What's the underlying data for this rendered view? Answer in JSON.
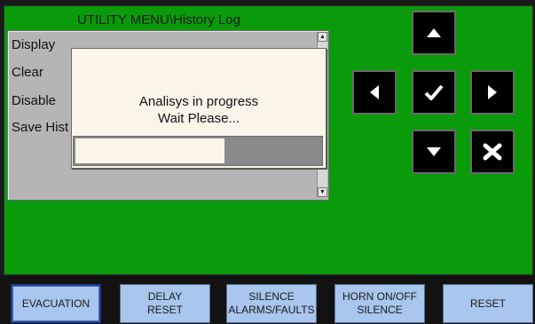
{
  "title": "UTILITY MENU\\History Log",
  "menu_items": [
    {
      "label": "Display"
    },
    {
      "label": "Clear"
    },
    {
      "label": "Disable"
    },
    {
      "label": "Save Hist"
    }
  ],
  "dialog": {
    "line1": "Analisys in progress",
    "line2": "Wait Please...",
    "progress_fraction": 0.61
  },
  "nav": {
    "up_icon": "arrow-up-icon",
    "left_icon": "arrow-left-icon",
    "ok_icon": "checkmark-icon",
    "right_icon": "arrow-right-icon",
    "down_icon": "arrow-down-icon",
    "cancel_icon": "cancel-x-icon"
  },
  "function_buttons": [
    {
      "label": "EVACUATION"
    },
    {
      "label": "DELAY\nRESET"
    },
    {
      "label": "SILENCE\nALARMS/FAULTS"
    },
    {
      "label": "HORN ON/OFF\nSILENCE"
    },
    {
      "label": "RESET"
    }
  ],
  "colors": {
    "screen_background": "#0a9b0a",
    "button_face": "#a8c6ee",
    "dialog_background": "#fbf6e9"
  }
}
